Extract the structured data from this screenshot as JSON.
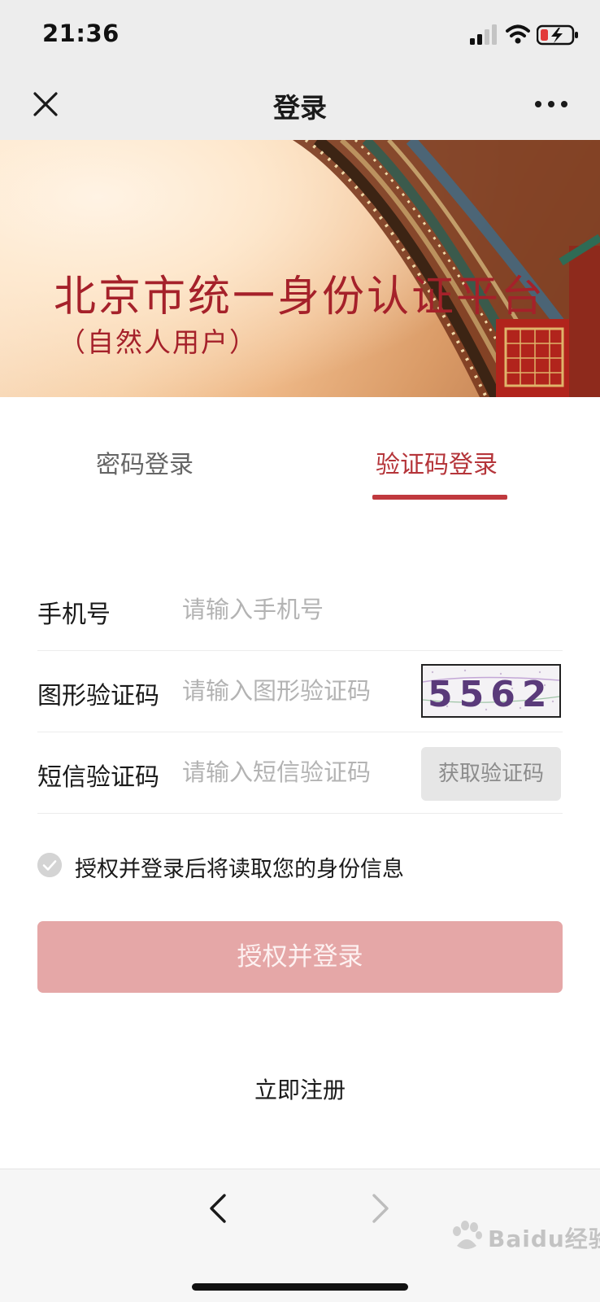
{
  "status_bar": {
    "time": "21:36"
  },
  "nav": {
    "title": "登录"
  },
  "banner": {
    "title": "北京市统一身份认证平台",
    "subtitle": "（自然人用户）"
  },
  "tabs": [
    {
      "label": "密码登录",
      "active": false
    },
    {
      "label": "验证码登录",
      "active": true
    }
  ],
  "form": {
    "phone": {
      "label": "手机号",
      "placeholder": "请输入手机号",
      "value": ""
    },
    "captcha": {
      "label": "图形验证码",
      "placeholder": "请输入图形验证码",
      "value": "",
      "image_text": "5562"
    },
    "sms": {
      "label": "短信验证码",
      "placeholder": "请输入短信验证码",
      "value": "",
      "button_label": "获取验证码"
    }
  },
  "agreement": {
    "text": "授权并登录后将读取您的身份信息",
    "checked": false
  },
  "submit": {
    "label": "授权并登录"
  },
  "register": {
    "label": "立即注册"
  },
  "watermark": {
    "text": "Baidu经验"
  },
  "colors": {
    "accent": "#c0393e",
    "title_red": "#a5212a",
    "submit_disabled": "#e5a7a7",
    "bar_gray": "#ededed"
  },
  "icons": [
    "close-icon",
    "more-icon",
    "signal-icon",
    "wifi-icon",
    "battery-charging-icon",
    "check-circle-icon",
    "back-arrow-icon",
    "forward-arrow-icon"
  ]
}
